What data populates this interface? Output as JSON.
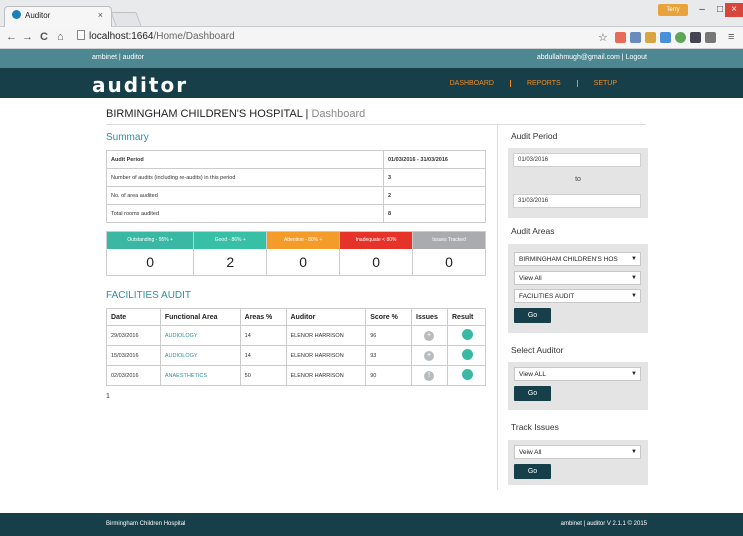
{
  "browser": {
    "tab_title": "Auditor",
    "tab_close": "×",
    "url_host": "localhost:1664",
    "url_path": "/Home/Dashboard",
    "profile_name": "Terry",
    "win_min": "–",
    "win_max": "□",
    "win_close": "×",
    "nav_back": "←",
    "nav_forward": "→",
    "nav_reload": "C",
    "nav_home": "⌂",
    "bookmark_star": "☆",
    "menu": "≡"
  },
  "topbar": {
    "left_text": "ambinet | auditor",
    "user_email": "abdullahmugh@gmail.com",
    "separator": "|",
    "logout": "Logout"
  },
  "header": {
    "logo": "auditor",
    "nav": [
      "DASHBOARD",
      "REPORTS",
      "SETUP"
    ]
  },
  "page": {
    "hospital": "BIRMINGHAM CHILDREN'S HOSPITAL",
    "separator": "|",
    "section": "Dashboard"
  },
  "summary": {
    "heading": "Summary",
    "rows": [
      {
        "label": "Audit Period",
        "value": "01/03/2016 - 31/03/2016"
      },
      {
        "label": "Number of audits (including re-audits) in this period",
        "value": "3"
      },
      {
        "label": "No. of area audited",
        "value": "2"
      },
      {
        "label": "Total rooms audited",
        "value": "8"
      }
    ]
  },
  "ratings": [
    {
      "label": "Outstanding - 95% +",
      "count": "0",
      "color": "#3bb8a3"
    },
    {
      "label": "Good - 86% +",
      "count": "2",
      "color": "#37c0a6"
    },
    {
      "label": "Attention - 80% +",
      "count": "0",
      "color": "#f39c2a"
    },
    {
      "label": "Inadequate < 80%",
      "count": "0",
      "color": "#e5332a"
    },
    {
      "label": "Issues Tracked",
      "count": "0",
      "color": "#a9abae"
    }
  ],
  "facilities": {
    "heading": "FACILITIES AUDIT",
    "columns": [
      "Date",
      "Functional Area",
      "Areas %",
      "Auditor",
      "Score %",
      "Issues",
      "Result"
    ],
    "rows": [
      {
        "date": "29/03/2016",
        "area": "AUDIOLOGY",
        "areas_pct": "14",
        "auditor": "ELENOR HARRISON",
        "score": "96",
        "issue_icon": "+"
      },
      {
        "date": "15/03/2016",
        "area": "AUDIOLOGY",
        "areas_pct": "14",
        "auditor": "ELENOR HARRISON",
        "score": "93",
        "issue_icon": "+"
      },
      {
        "date": "02/03/2016",
        "area": "ANAESTHETICS",
        "areas_pct": "50",
        "auditor": "ELENOR HARRISON",
        "score": "90",
        "issue_icon": "!"
      }
    ],
    "page": "1"
  },
  "sidebar": {
    "audit_period": {
      "heading": "Audit Period",
      "from": "01/03/2016",
      "to_label": "to",
      "to": "31/03/2016"
    },
    "audit_areas": {
      "heading": "Audit Areas",
      "hospital_select": "BIRMINGHAM CHILDREN'S HOS",
      "view_select": "View All",
      "type_select": "FACILITIES AUDIT",
      "go": "Go"
    },
    "select_auditor": {
      "heading": "Select Auditor",
      "select": "View ALL",
      "go": "Go"
    },
    "track_issues": {
      "heading": "Track Issues",
      "select": "Veiw All",
      "go": "Go"
    },
    "caret": "▼"
  },
  "footer": {
    "left": "Birmingham Children Hospital",
    "right": "ambinet | auditor V 2.1.1 © 2015"
  }
}
